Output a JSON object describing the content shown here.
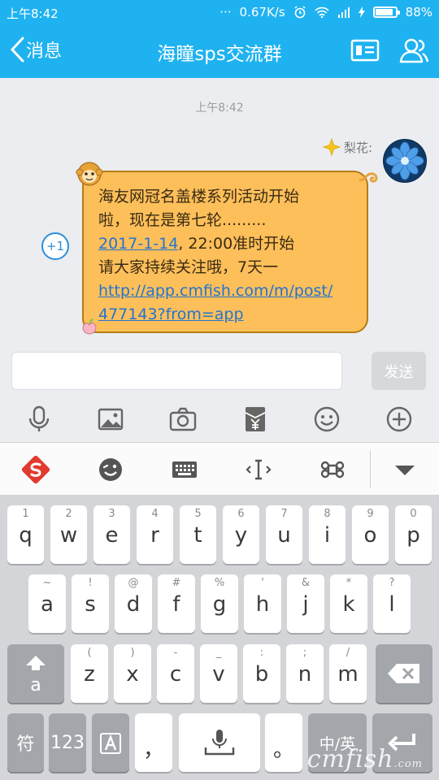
{
  "status_bar": {
    "time": "上午8:42",
    "dots": "···",
    "network_speed": "0.67K/s",
    "battery_percent": "88%",
    "battery_level": 0.88
  },
  "header": {
    "back_label": "消息",
    "title": "海瞳sps交流群"
  },
  "chat": {
    "timestamp": "上午8:42",
    "sender_name": "梨花:",
    "plus_one": "+1",
    "message": {
      "line1": "海友网冠名盖楼系列活动开始",
      "line2": "啦，现在是第七轮.........",
      "date_link": "2017-1-14",
      "line3_rest": ", 22:00准时开始",
      "line4": "请大家持续关注哦，7天一",
      "url_line1": "http://app.cmfish.com/m/post/",
      "url_line2": "477143?from=app"
    }
  },
  "composer": {
    "input_value": "",
    "send_label": "发送"
  },
  "panel_icons": [
    "microphone-icon",
    "image-icon",
    "camera-icon",
    "red-packet-icon",
    "emoji-icon",
    "plus-icon"
  ],
  "keyboard": {
    "row1": [
      {
        "hint": "1",
        "key": "q"
      },
      {
        "hint": "2",
        "key": "w"
      },
      {
        "hint": "3",
        "key": "e"
      },
      {
        "hint": "4",
        "key": "r"
      },
      {
        "hint": "5",
        "key": "t"
      },
      {
        "hint": "6",
        "key": "y"
      },
      {
        "hint": "7",
        "key": "u"
      },
      {
        "hint": "8",
        "key": "i"
      },
      {
        "hint": "9",
        "key": "o"
      },
      {
        "hint": "0",
        "key": "p"
      }
    ],
    "row2": [
      {
        "hint": "~",
        "key": "a"
      },
      {
        "hint": "!",
        "key": "s"
      },
      {
        "hint": "@",
        "key": "d"
      },
      {
        "hint": "#",
        "key": "f"
      },
      {
        "hint": "%",
        "key": "g"
      },
      {
        "hint": "'",
        "key": "h"
      },
      {
        "hint": "&",
        "key": "j"
      },
      {
        "hint": "*",
        "key": "k"
      },
      {
        "hint": "?",
        "key": "l"
      }
    ],
    "row3": [
      {
        "hint": "(",
        "key": "z"
      },
      {
        "hint": ")",
        "key": "x"
      },
      {
        "hint": "-",
        "key": "c"
      },
      {
        "hint": "_",
        "key": "v"
      },
      {
        "hint": ":",
        "key": "b"
      },
      {
        "hint": ";",
        "key": "n"
      },
      {
        "hint": "/",
        "key": "m"
      }
    ],
    "shift_letter": "a",
    "symbols_label": "符",
    "numbers_label": "123",
    "comma": "，",
    "period": "。",
    "lang_label": "中/英"
  },
  "watermark": {
    "brand": "cmfish",
    "suffix": ".com"
  },
  "colors": {
    "header_blue": "#1fb2f0",
    "bubble_orange": "#fdbf5a",
    "link_blue": "#2374d0"
  }
}
